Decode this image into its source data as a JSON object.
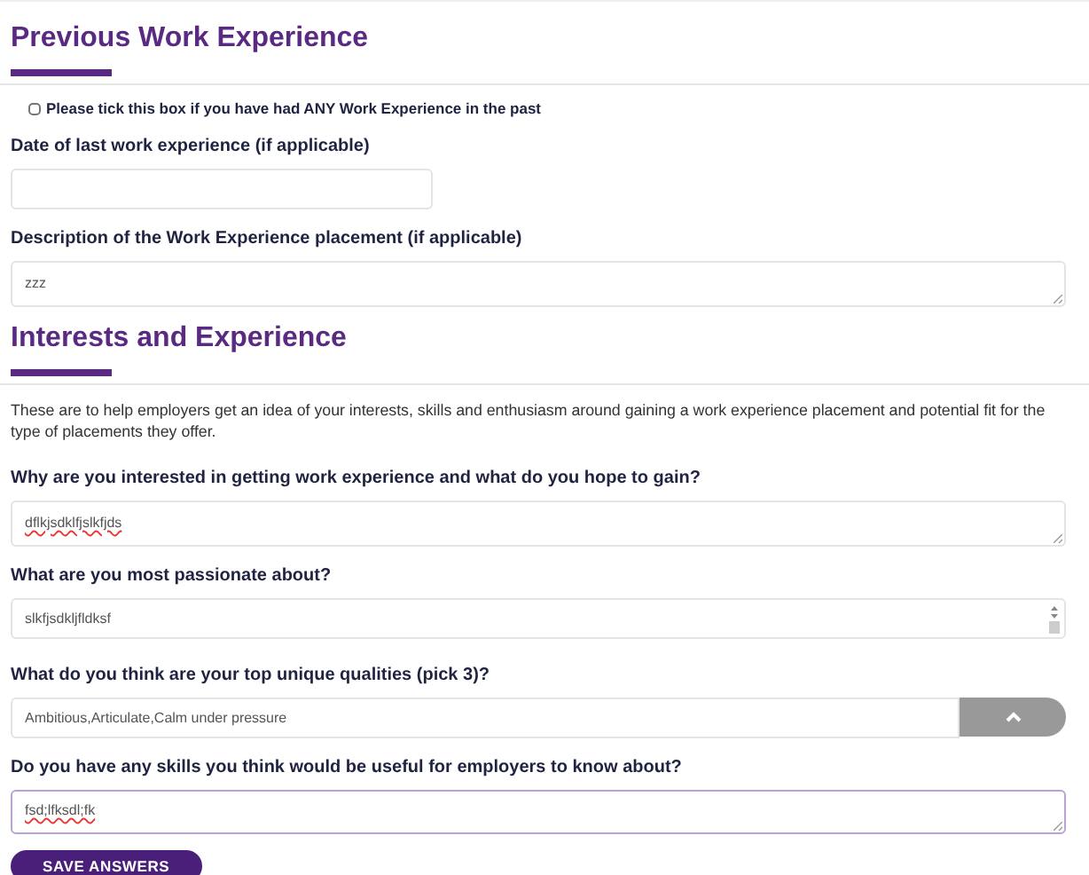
{
  "sections": [
    {
      "title": "Previous Work Experience",
      "items": [
        {
          "kind": "checkbox",
          "label": "Please tick this box if you have had ANY Work Experience in the past",
          "checked": false
        },
        {
          "kind": "short",
          "label": "Date of last work experience (if applicable)"
        },
        {
          "kind": "textarea",
          "label": "Description of the Work Experience placement (if applicable)",
          "value": "zzz",
          "misspelled": false,
          "focused": false
        }
      ]
    },
    {
      "title": "Interests and Experience",
      "items": [
        {
          "kind": "paragraph",
          "text": "These are to help employers get an idea of your interests, skills and enthusiasm around gaining a work experience placement and potential fit for the type of placements they offer."
        },
        {
          "kind": "textarea",
          "label": "Why are you interested in getting work experience and what do you hope to gain?",
          "value": "dflkjsdklfjslkfjds",
          "misspelled": true,
          "focused": false
        },
        {
          "kind": "scroll",
          "label": "What are you most passionate about?",
          "value": "slkfjsdkljfldksf",
          "misspelled": false
        },
        {
          "kind": "select",
          "label": "What do you think are your top unique qualities (pick 3)?",
          "value": "Ambitious,Articulate,Calm under pressure",
          "expanded": true
        },
        {
          "kind": "textarea",
          "label": "Do you have any skills you think would be useful for employers to know about?",
          "value": "fsd;lfksdl;fk",
          "misspelled": true,
          "focused": true
        }
      ]
    }
  ],
  "button": "SAVE ANSWERS"
}
